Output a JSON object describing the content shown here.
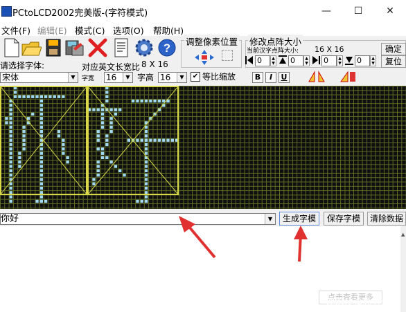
{
  "window": {
    "title": "PCtoLCD2002完美版-(字符模式)",
    "minimize_glyph": "—",
    "maximize_glyph": "☐",
    "close_glyph": "✕"
  },
  "menu": [
    "文件(F)",
    "编辑(E)",
    "模式(C)",
    "选项(O)",
    "帮助(H)"
  ],
  "toolbar_icons": [
    "new-file-icon",
    "open-folder-icon",
    "save-icon",
    "save-as-icon",
    "delete-icon",
    "notepad-icon",
    "settings-gear-icon",
    "help-icon"
  ],
  "font": {
    "select_label": "请选择字体:",
    "font_value": "宋体",
    "width_label_caption": "对应英文长宽比",
    "ratio_value": "8 X 16",
    "width_label": "字宽",
    "width_value": "16",
    "height_label": "字高",
    "height_value": "16",
    "proportional_label": "等比缩放",
    "proportional_checked": true
  },
  "format_buttons": [
    "B",
    "I",
    "U"
  ],
  "adjust": {
    "title": "调整像素位置"
  },
  "dot_matrix": {
    "title": "修改点阵大小",
    "current_label": "当前汉字点阵大小:",
    "current_value": "16 X 16",
    "spin_values": [
      "0",
      "0",
      "0",
      "0"
    ],
    "confirm_label": "确定",
    "reset_label": "复位"
  },
  "text_input": {
    "value": "你好"
  },
  "buttons": {
    "generate": "生成字模",
    "save": "保存字模",
    "clear": "清除数据",
    "ghost": "点击查看更多"
  },
  "watermark": "CSDN @秋野酱",
  "colors": {
    "grid_bg": "#0f0f0f",
    "grid_line": "#5e6c22",
    "pixel_on": "#9fd8f0",
    "frame": "#d8d84a",
    "arrow_red": "#e03030"
  }
}
